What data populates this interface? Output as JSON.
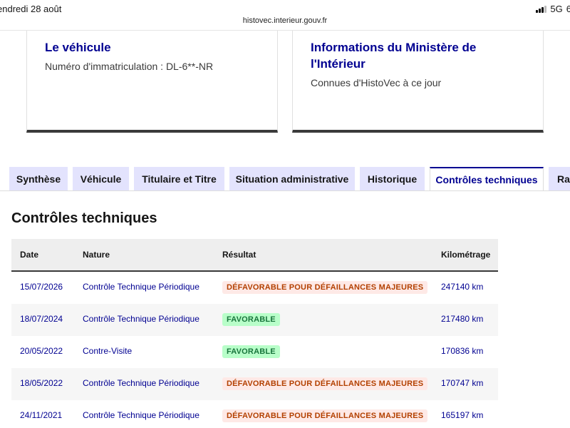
{
  "status_bar": {
    "time": "endredi 28 août",
    "network": "5G",
    "battery": "6",
    "signal_icon": "signal-icon"
  },
  "browser": {
    "url": "histovec.interieur.gouv.fr"
  },
  "cards": {
    "vehicle": {
      "title": "Le véhicule",
      "text": "Numéro d'immatriculation : DL-6**-NR"
    },
    "ministry": {
      "title": "Informations du Ministère de l'Intérieur",
      "text": "Connues d'HistoVec à ce jour"
    }
  },
  "tabs": [
    {
      "label": "Synthèse",
      "active": false
    },
    {
      "label": "Véhicule",
      "active": false
    },
    {
      "label": "Titulaire et Titre",
      "active": false
    },
    {
      "label": "Situation administrative",
      "active": false
    },
    {
      "label": "Historique",
      "active": false
    },
    {
      "label": "Contrôles techniques",
      "active": true
    },
    {
      "label": "Rap",
      "active": false
    }
  ],
  "panel": {
    "title": "Contrôles techniques",
    "columns": [
      "Date",
      "Nature",
      "Résultat",
      "Kilométrage"
    ],
    "rows": [
      {
        "date": "15/07/2026",
        "nature": "Contrôle Technique Périodique",
        "result": "DÉFAVORABLE POUR DÉFAILLANCES MAJEURES",
        "status": "bad",
        "km": "247140 km"
      },
      {
        "date": "18/07/2024",
        "nature": "Contrôle Technique Périodique",
        "result": "FAVORABLE",
        "status": "good",
        "km": "217480 km"
      },
      {
        "date": "20/05/2022",
        "nature": "Contre-Visite",
        "result": "FAVORABLE",
        "status": "good",
        "km": "170836 km"
      },
      {
        "date": "18/05/2022",
        "nature": "Contrôle Technique Périodique",
        "result": "DÉFAVORABLE POUR DÉFAILLANCES MAJEURES",
        "status": "bad",
        "km": "170747 km"
      },
      {
        "date": "24/11/2021",
        "nature": "Contrôle Technique Périodique",
        "result": "DÉFAVORABLE POUR DÉFAILLANCES MAJEURES",
        "status": "bad",
        "km": "165197 km"
      }
    ]
  },
  "colors": {
    "primary": "#000091",
    "tab_bg": "#e3e3fd",
    "bad_bg": "#fee9e6",
    "bad_text": "#b34000",
    "good_bg": "#b8fec9",
    "good_text": "#18753c"
  }
}
